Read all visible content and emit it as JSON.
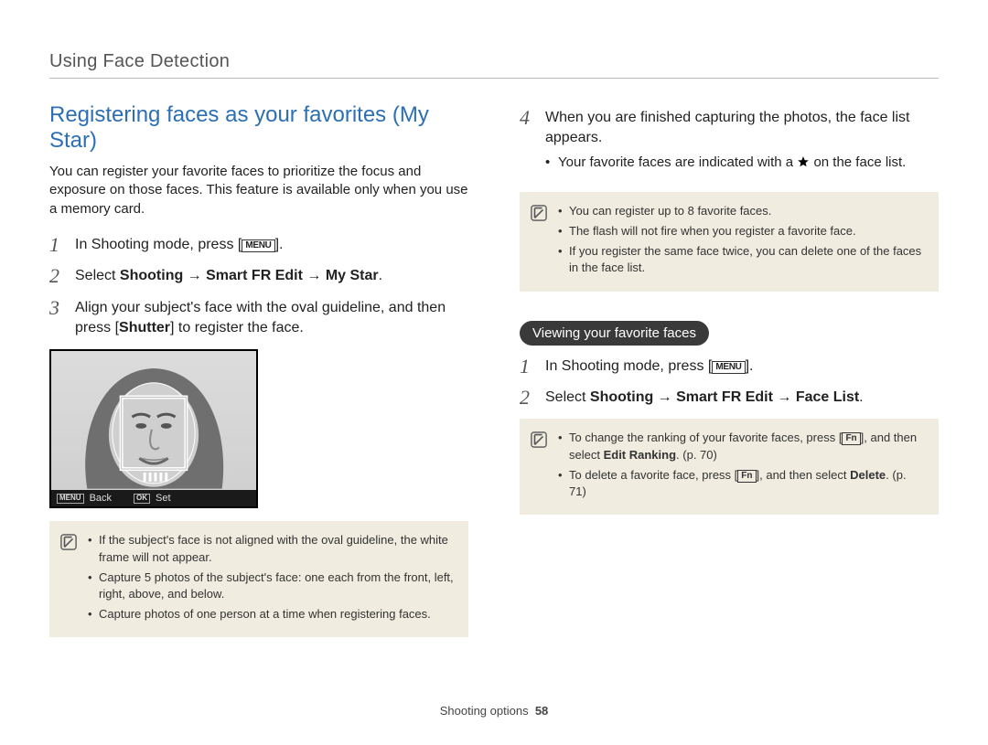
{
  "header": {
    "section": "Using Face Detection"
  },
  "left": {
    "title": "Registering faces as your favorites (My Star)",
    "intro": "You can register your favorite faces to prioritize the focus and exposure on those faces. This feature is available only when you use a memory card.",
    "steps": {
      "s1_pre": "In Shooting mode, press [",
      "s1_menu": "MENU",
      "s1_post": "].",
      "s2_pre": "Select ",
      "s2_b1": "Shooting",
      "s2_arr": " → ",
      "s2_b2": "Smart FR Edit",
      "s2_b3": "My Star",
      "s2_post": ".",
      "s3a": "Align your subject's face with the oval guideline, and then press [",
      "s3_shutter": "Shutter",
      "s3b": "] to register the face."
    },
    "screenshot": {
      "back_icon": "MENU",
      "back_label": "Back",
      "ok_icon": "OK",
      "ok_label": "Set"
    },
    "note1": {
      "b1": "If the subject's face is not aligned with the oval guideline, the white frame will not appear.",
      "b2": "Capture 5 photos of the subject's face: one each from the front, left, right, above, and below.",
      "b3": "Capture photos of one person at a time when registering faces."
    }
  },
  "right": {
    "step4a": "When you are finished capturing the photos, the face list appears.",
    "step4_bullet_pre": "Your favorite faces are indicated with a ",
    "step4_bullet_post": " on the face list.",
    "note2": {
      "b1": "You can register up to 8 favorite faces.",
      "b2": "The flash will not fire when you register a favorite face.",
      "b3": "If you register the same face twice, you can delete one of the faces in the face list."
    },
    "pill": "Viewing your favorite faces",
    "vsteps": {
      "s1_pre": "In Shooting mode, press [",
      "s1_menu": "MENU",
      "s1_post": "].",
      "s2_pre": "Select ",
      "s2_b1": "Shooting",
      "s2_arr": " → ",
      "s2_b2": "Smart FR Edit",
      "s2_b3": "Face List",
      "s2_post": "."
    },
    "note3": {
      "b1_pre": "To change the ranking of your favorite faces, press [",
      "b1_fn": "Fn",
      "b1_mid": "], and then select ",
      "b1_bold": "Edit Ranking",
      "b1_post": ". (p. 70)",
      "b2_pre": "To delete a favorite face, press [",
      "b2_fn": "Fn",
      "b2_mid": "], and then select ",
      "b2_bold": "Delete",
      "b2_post": ". (p. 71)"
    }
  },
  "footer": {
    "section": "Shooting options",
    "page": "58"
  }
}
